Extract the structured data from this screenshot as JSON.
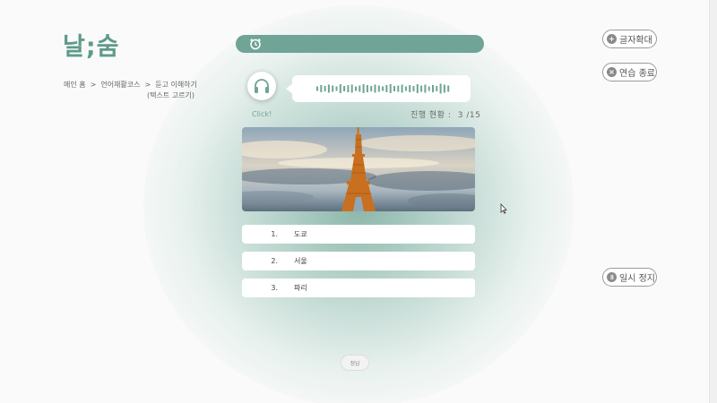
{
  "app": {
    "logo": "날;숨"
  },
  "breadcrumb": {
    "items": [
      "메인 홈",
      "언어재활코스",
      "듣고 이해하기"
    ],
    "separator": ">",
    "subtitle": "(텍스트 고르기)"
  },
  "side_buttons": {
    "zoom": {
      "label": "글자확대",
      "icon": "plus-icon"
    },
    "end": {
      "label": "연습 종료",
      "icon": "x-icon"
    },
    "pause": {
      "label": "일시 정지",
      "icon": "pause-icon"
    }
  },
  "audio": {
    "click_label": "Click!",
    "icon": "headphones-icon"
  },
  "progress": {
    "label": "진행 현황 :",
    "value": "3 /15",
    "current": 3,
    "total": 15
  },
  "options": [
    {
      "num": "1.",
      "text": "도쿄"
    },
    {
      "num": "2.",
      "text": "서울"
    },
    {
      "num": "3.",
      "text": "파리"
    }
  ],
  "bottom_button": {
    "label": "정답"
  },
  "colors": {
    "accent": "#6fa496",
    "logo": "#5f9a8a"
  }
}
